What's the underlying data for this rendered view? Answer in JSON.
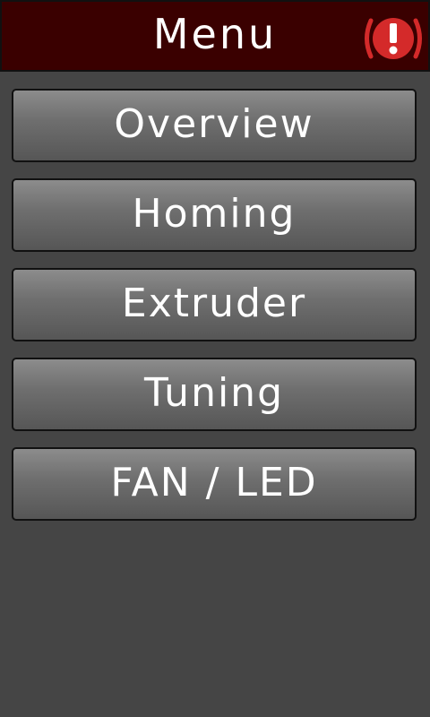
{
  "header": {
    "title": "Menu",
    "alert_icon": "alert-icon"
  },
  "menu": {
    "items": [
      {
        "label": "Overview"
      },
      {
        "label": "Homing"
      },
      {
        "label": "Extruder"
      },
      {
        "label": "Tuning"
      },
      {
        "label": "FAN / LED"
      }
    ]
  },
  "colors": {
    "header_bg": "#3a0000",
    "alert_red": "#d42a2a",
    "button_top": "#8c8c8c",
    "button_bottom": "#565656",
    "screen_bg": "#454545",
    "text": "#ffffff"
  }
}
